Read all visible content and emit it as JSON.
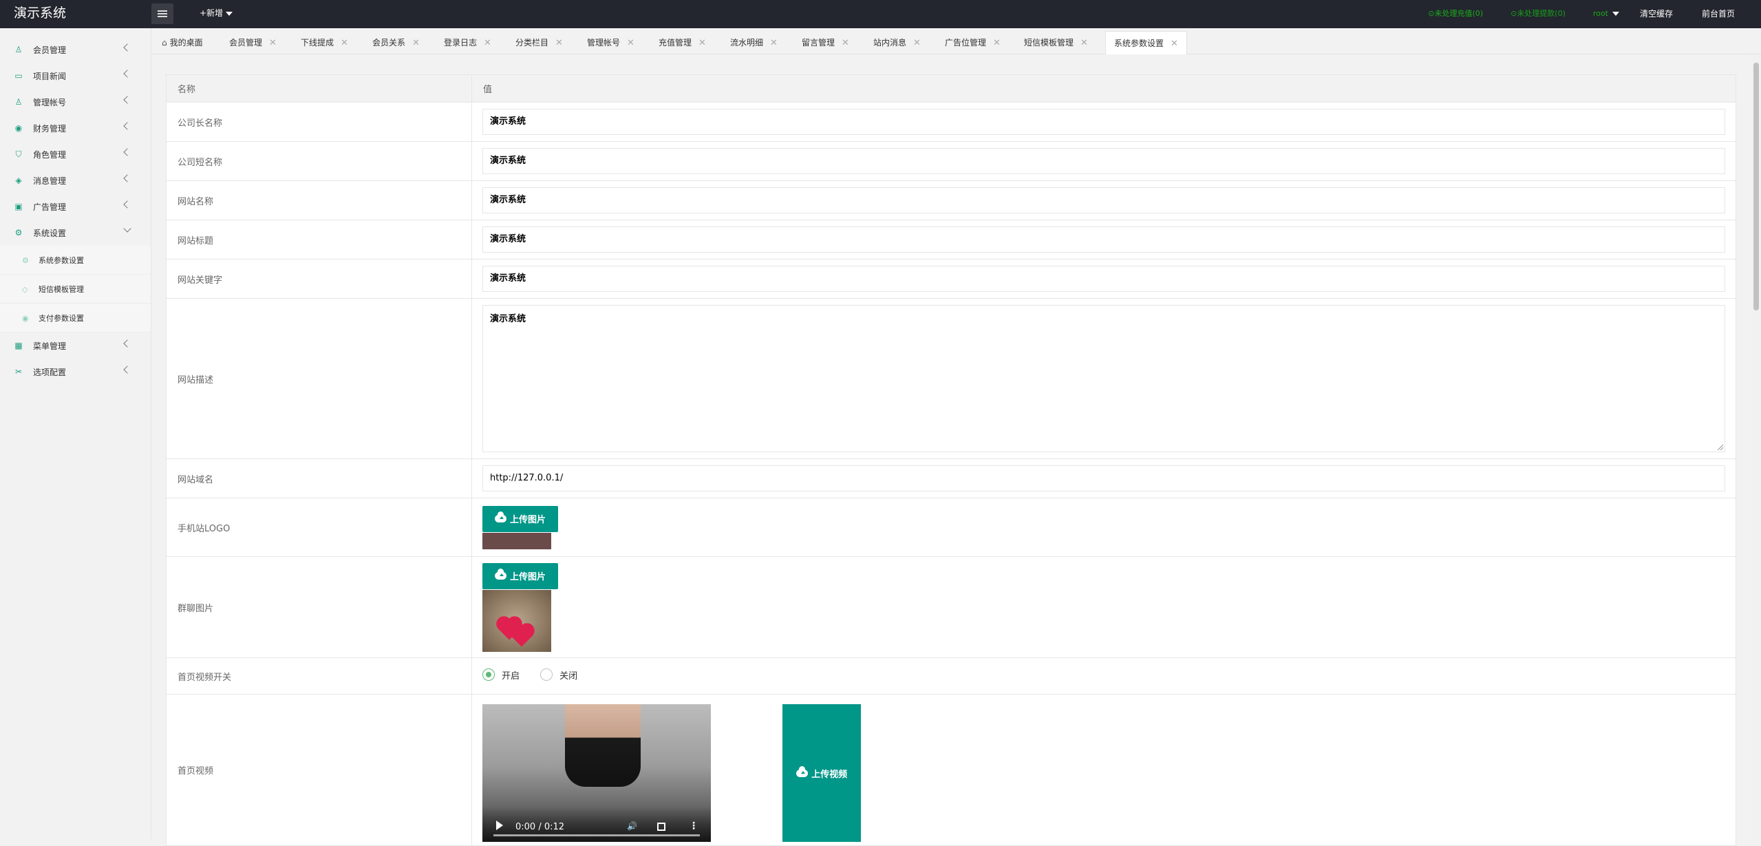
{
  "app": {
    "title": "演示系统",
    "add_label": "+新增"
  },
  "topbar": {
    "recharge": "未处理充值(0)",
    "withdraw": "未处理提款(0)",
    "user": "root",
    "clear_cache": "清空缓存",
    "front_home": "前台首页"
  },
  "sidebar": {
    "items": [
      {
        "label": "会员管理",
        "icon": "user-icon"
      },
      {
        "label": "项目新闻",
        "icon": "book-icon"
      },
      {
        "label": "管理帐号",
        "icon": "account-icon"
      },
      {
        "label": "财务管理",
        "icon": "finance-icon"
      },
      {
        "label": "角色管理",
        "icon": "shield-icon"
      },
      {
        "label": "消息管理",
        "icon": "message-icon"
      },
      {
        "label": "广告管理",
        "icon": "image-icon"
      },
      {
        "label": "系统设置",
        "icon": "gear-icon"
      }
    ],
    "sub_items": [
      {
        "label": "系统参数设置"
      },
      {
        "label": "短信模板管理"
      },
      {
        "label": "支付参数设置"
      }
    ],
    "items_after": [
      {
        "label": "菜单管理",
        "icon": "grid-icon"
      },
      {
        "label": "选项配置",
        "icon": "tool-icon"
      }
    ]
  },
  "tabs": [
    "我的桌面",
    "会员管理",
    "下线提成",
    "会员关系",
    "登录日志",
    "分类栏目",
    "管理帐号",
    "充值管理",
    "流水明细",
    "留言管理",
    "站内消息",
    "广告位管理",
    "短信模板管理",
    "系统参数设置"
  ],
  "table": {
    "header_name": "名称",
    "header_value": "值",
    "rows": {
      "company_long": {
        "label": "公司长名称",
        "value": "演示系统"
      },
      "company_short": {
        "label": "公司短名称",
        "value": "演示系统"
      },
      "site_name": {
        "label": "网站名称",
        "value": "演示系统"
      },
      "site_title": {
        "label": "网站标题",
        "value": "演示系统"
      },
      "site_keywords": {
        "label": "网站关键字",
        "value": "演示系统"
      },
      "site_desc": {
        "label": "网站描述",
        "value": "演示系统"
      },
      "site_domain": {
        "label": "网站域名",
        "value": "http://127.0.0.1/"
      },
      "mobile_logo": {
        "label": "手机站LOGO",
        "button": "上传图片"
      },
      "group_img": {
        "label": "群聊图片",
        "button": "上传图片"
      },
      "video_switch": {
        "label": "首页视频开关",
        "on": "开启",
        "off": "关闭",
        "selected": "on"
      },
      "home_video": {
        "label": "首页视频",
        "time": "0:00 / 0:12",
        "button": "上传视频"
      }
    }
  },
  "colors": {
    "accent": "#009688",
    "topbar": "#23262e",
    "status_green": "#1aad19"
  }
}
